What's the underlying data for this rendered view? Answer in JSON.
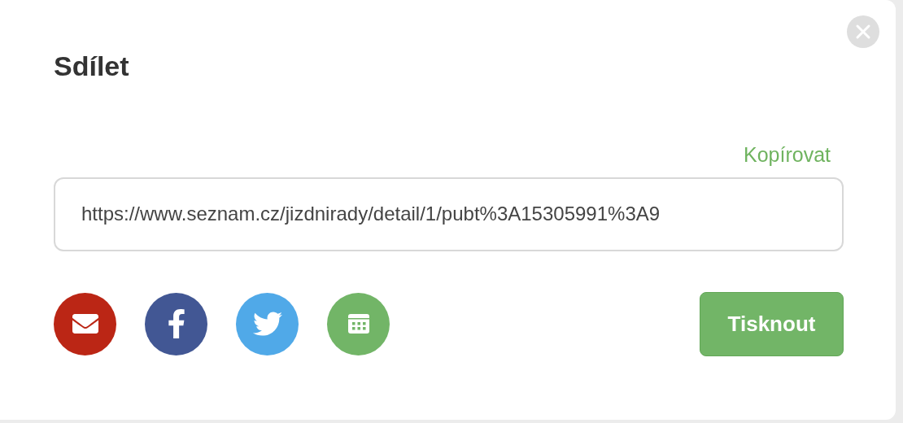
{
  "dialog": {
    "title": "Sdílet",
    "copy_link": "Kopírovat",
    "url_field": {
      "value": "https://www.seznam.cz/jizdnirady/detail/1/pubt%3A15305991%3A9"
    },
    "share_buttons": [
      {
        "kind": "email",
        "color": "#bb2615"
      },
      {
        "kind": "facebook",
        "color": "#425794"
      },
      {
        "kind": "twitter",
        "color": "#50a9e8"
      },
      {
        "kind": "calendar",
        "color": "#72b567"
      }
    ],
    "print_button": "Tisknout"
  }
}
